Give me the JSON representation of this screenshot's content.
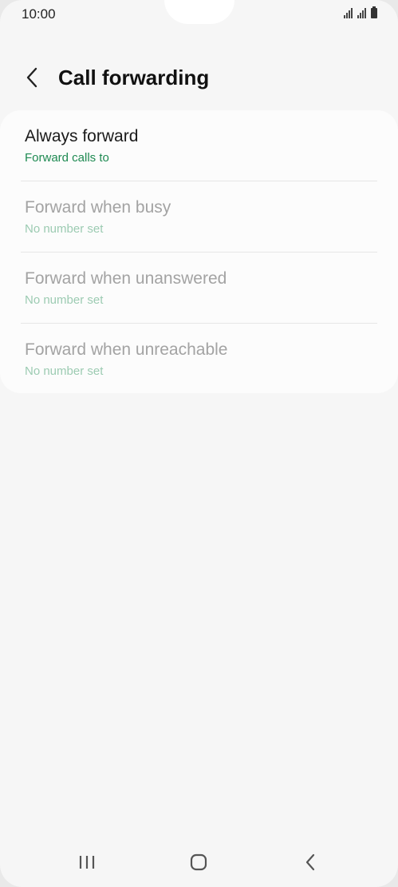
{
  "status_bar": {
    "time": "10:00",
    "icons": [
      "signal-icon",
      "signal-icon",
      "battery-icon"
    ]
  },
  "header": {
    "title": "Call forwarding",
    "back_icon": "chevron-left-icon"
  },
  "colors": {
    "accent": "#1e8a52",
    "accent_disabled": "#9ccbb2",
    "background": "#f6f6f6",
    "card": "#fcfcfc"
  },
  "options": [
    {
      "title": "Always forward",
      "subtitle": "Forward calls to",
      "enabled": true
    },
    {
      "title": "Forward when busy",
      "subtitle": "No number set",
      "enabled": false
    },
    {
      "title": "Forward when unanswered",
      "subtitle": "No number set",
      "enabled": false
    },
    {
      "title": "Forward when unreachable",
      "subtitle": "No number set",
      "enabled": false
    }
  ],
  "nav_bar": {
    "buttons": [
      "recent-apps-icon",
      "home-icon",
      "back-icon"
    ]
  }
}
